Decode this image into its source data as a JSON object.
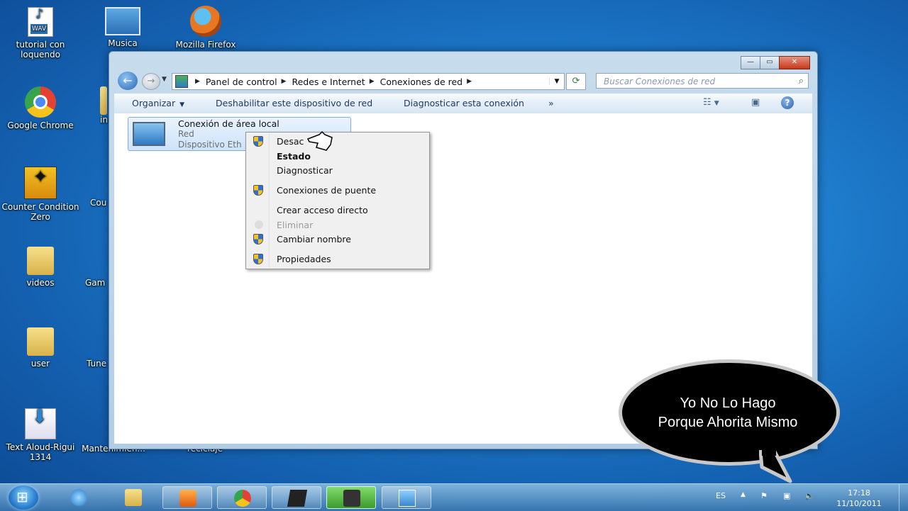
{
  "desktop": {
    "icons": [
      {
        "label": "tutorial con loquendo"
      },
      {
        "label": "Musica"
      },
      {
        "label": "Mozilla Firefox"
      },
      {
        "label": "Google Chrome"
      },
      {
        "label": "in"
      },
      {
        "label": "Counter Condition Zero"
      },
      {
        "label": "Cou"
      },
      {
        "label": "videos"
      },
      {
        "label": "Gam"
      },
      {
        "label": "user"
      },
      {
        "label": "Tune"
      },
      {
        "label": "Text Aloud-Rigui 1314"
      },
      {
        "label": "Mantenimien..."
      },
      {
        "label": "reciclaje"
      }
    ]
  },
  "window": {
    "controls": {
      "minimize": "—",
      "maximize": "▭",
      "close": "✕"
    },
    "breadcrumb": [
      "Panel de control",
      "Redes e Internet",
      "Conexiones de red"
    ],
    "search_placeholder": "Buscar Conexiones de red",
    "commands": {
      "organize": "Organizar",
      "disable": "Deshabilitar este dispositivo de red",
      "diagnose": "Diagnosticar esta conexión",
      "more": "»"
    },
    "connection": {
      "name": "Conexión de área local",
      "network": "Red",
      "device": "Dispositivo Eth"
    }
  },
  "context_menu": {
    "items": [
      {
        "label": "Desac",
        "shield": true
      },
      {
        "label": "Estado"
      },
      {
        "label": "Diagnosticar"
      },
      {
        "label": "Conexiones de puente",
        "shield": true
      },
      {
        "label": "Crear acceso directo"
      },
      {
        "label": "Eliminar",
        "disabled": true
      },
      {
        "label": "Cambiar nombre",
        "shield": true
      },
      {
        "label": "Propiedades",
        "shield": true
      }
    ]
  },
  "bubble": {
    "line1": "Yo No Lo Hago",
    "line2": "Porque Ahorita Mismo"
  },
  "taskbar": {
    "language": "ES",
    "time": "17:18",
    "date": "11/10/2011"
  }
}
